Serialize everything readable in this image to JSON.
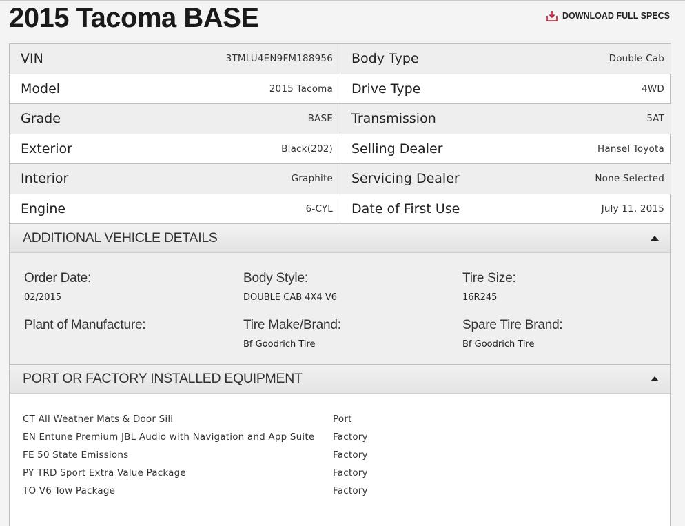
{
  "page_title": "2015 Tacoma BASE",
  "download_label": "DOWNLOAD FULL SPECS",
  "specs_left": [
    {
      "label": "VIN",
      "value": "3TMLU4EN9FM188956"
    },
    {
      "label": "Model",
      "value": "2015 Tacoma"
    },
    {
      "label": "Grade",
      "value": "BASE"
    },
    {
      "label": "Exterior",
      "value": "Black(202)"
    },
    {
      "label": "Interior",
      "value": "Graphite"
    },
    {
      "label": "Engine",
      "value": "6-CYL"
    }
  ],
  "specs_right": [
    {
      "label": "Body Type",
      "value": "Double Cab"
    },
    {
      "label": "Drive Type",
      "value": "4WD"
    },
    {
      "label": "Transmission",
      "value": "5AT"
    },
    {
      "label": "Selling Dealer",
      "value": "Hansel Toyota"
    },
    {
      "label": "Servicing Dealer",
      "value": "None Selected"
    },
    {
      "label": "Date of First Use",
      "value": "July 11, 2015"
    }
  ],
  "additional": {
    "title": "ADDITIONAL VEHICLE DETAILS",
    "items": [
      {
        "label": "Order Date:",
        "value": "02/2015"
      },
      {
        "label": "Body Style:",
        "value": "DOUBLE CAB 4X4 V6"
      },
      {
        "label": "Tire Size:",
        "value": "16R245"
      },
      {
        "label": "Plant of Manufacture:",
        "value": ""
      },
      {
        "label": "Tire Make/Brand:",
        "value": "Bf Goodrich Tire"
      },
      {
        "label": "Spare Tire Brand:",
        "value": "Bf Goodrich Tire"
      }
    ]
  },
  "equipment": {
    "title": "PORT OR FACTORY INSTALLED EQUIPMENT",
    "items": [
      {
        "name": "CT All Weather Mats & Door Sill",
        "type": "Port"
      },
      {
        "name": "EN Entune Premium JBL Audio with Navigation and App Suite",
        "type": "Factory"
      },
      {
        "name": "FE 50 State Emissions",
        "type": "Factory"
      },
      {
        "name": "PY TRD Sport Extra Value Package",
        "type": "Factory"
      },
      {
        "name": "TO V6 Tow Package",
        "type": "Factory"
      }
    ]
  },
  "colors": {
    "download_icon": "#c8102e",
    "shade_row": "#eeeeee",
    "border": "#bdbdbd"
  },
  "icons": {
    "download": "download-icon",
    "collapse": "caret-up-icon"
  }
}
